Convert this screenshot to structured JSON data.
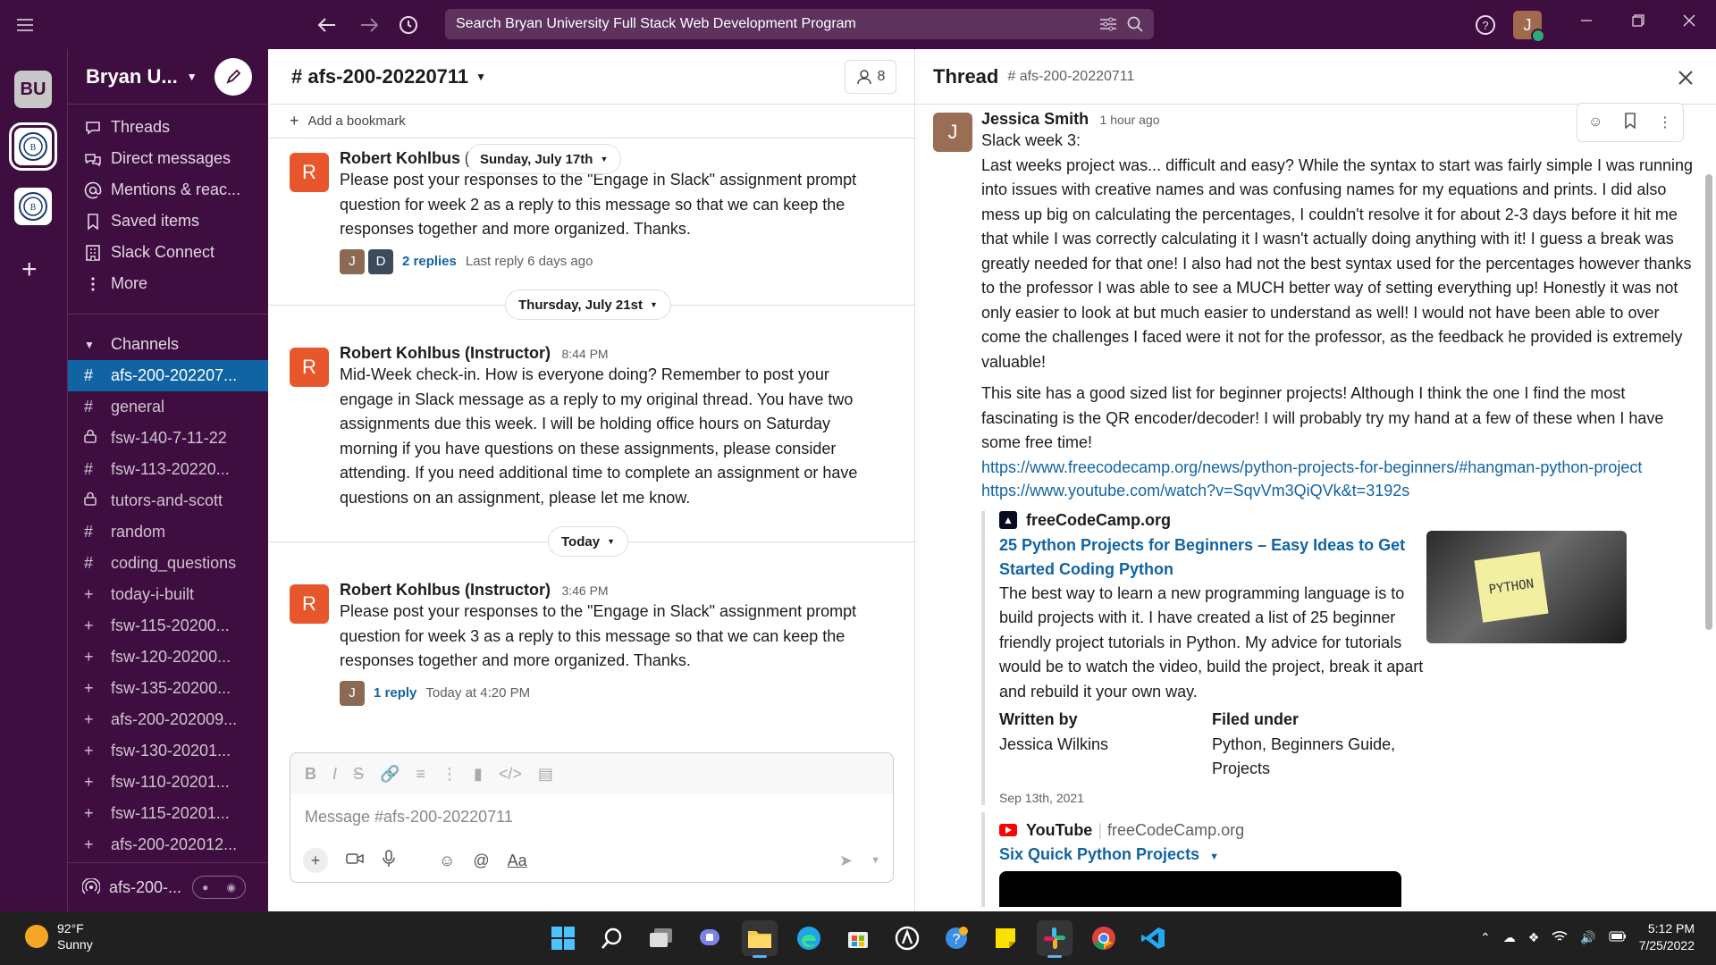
{
  "topbar": {
    "search_placeholder": "Search Bryan University Full Stack Web Development Program",
    "user_initial": "J"
  },
  "rail": {
    "workspace_initials": "BU"
  },
  "sidebar": {
    "workspace_name": "Bryan U...",
    "nav": [
      {
        "label": "Threads",
        "icon": "threads-icon"
      },
      {
        "label": "Direct messages",
        "icon": "dm-icon"
      },
      {
        "label": "Mentions & reac...",
        "icon": "at-icon"
      },
      {
        "label": "Saved items",
        "icon": "bookmark-icon"
      },
      {
        "label": "Slack Connect",
        "icon": "building-icon"
      },
      {
        "label": "More",
        "icon": "more-vertical-icon"
      }
    ],
    "channels_heading": "Channels",
    "channels": [
      {
        "prefix": "#",
        "name": "afs-200-202207..."
      },
      {
        "prefix": "#",
        "name": "general"
      },
      {
        "prefix": "lock",
        "name": "fsw-140-7-11-22"
      },
      {
        "prefix": "#",
        "name": "fsw-113-20220..."
      },
      {
        "prefix": "lock",
        "name": "tutors-and-scott"
      },
      {
        "prefix": "#",
        "name": "random"
      },
      {
        "prefix": "#",
        "name": "coding_questions"
      },
      {
        "prefix": "+",
        "name": "today-i-built"
      },
      {
        "prefix": "+",
        "name": "fsw-115-20200..."
      },
      {
        "prefix": "+",
        "name": "fsw-120-20200..."
      },
      {
        "prefix": "+",
        "name": "fsw-135-20200..."
      },
      {
        "prefix": "+",
        "name": "afs-200-202009..."
      },
      {
        "prefix": "+",
        "name": "fsw-130-20201..."
      },
      {
        "prefix": "+",
        "name": "fsw-110-20201..."
      },
      {
        "prefix": "+",
        "name": "fsw-115-20201..."
      },
      {
        "prefix": "+",
        "name": "afs-200-202012..."
      }
    ],
    "huddle_label": "afs-200-..."
  },
  "channel": {
    "title": "# afs-200-20220711",
    "member_count": "8",
    "bookmark_label": "Add a bookmark",
    "date_pills": [
      "Sunday, July 17th",
      "Thursday, July 21st",
      "Today"
    ],
    "messages": [
      {
        "initial": "R",
        "author": "Robert Kohlbus (Instruc",
        "time": "",
        "text": "Please post your responses to the \"Engage in Slack\" assignment prompt question for week 2 as a reply to this message so that we can keep the responses together and more organized. Thanks.",
        "reply_avatars": [
          "J",
          "D"
        ],
        "reply_count": "2 replies",
        "reply_meta": "Last reply 6 days ago"
      },
      {
        "initial": "R",
        "author": "Robert Kohlbus (Instructor)",
        "time": "8:44 PM",
        "text": "Mid-Week check-in. How is everyone doing?  Remember to post your engage in Slack message as a reply to my original thread.  You have two assignments due this week.  I will be holding office hours on Saturday morning if you have questions on these assignments, please consider attending.  If you need additional time to complete an assignment or have questions on an assignment, please let me know."
      },
      {
        "initial": "R",
        "author": "Robert Kohlbus (Instructor)",
        "time": "3:46 PM",
        "text": "Please post your responses to the \"Engage in Slack\" assignment prompt question for week 3 as a reply to this message so that we can keep the responses together and more organized. Thanks.",
        "reply_avatars": [
          "J"
        ],
        "reply_count": "1 reply",
        "reply_meta": "Today at 4:20 PM"
      }
    ],
    "composer_placeholder": "Message #afs-200-20220711",
    "format_label": "Aa"
  },
  "thread": {
    "title": "Thread",
    "channel": "# afs-200-20220711",
    "author_initial": "J",
    "author": "Jessica Smith",
    "time": "1 hour ago",
    "para1": "Slack week 3:",
    "para2": "Last weeks project was... difficult and easy? While the syntax to start was fairly simple I was running into issues with creative names and was confusing names for my equations and prints. I did also mess up big on calculating the percentages, I couldn't resolve it for about 2-3 days before it hit me that while I was correctly calculating it I wasn't actually doing anything with it! I guess a break was greatly needed for that one! I also had not the best syntax used for the percentages however thanks to the professor I was able to see a MUCH better way of setting everything up! Honestly it was not only easier to look at but much easier to understand as well! I would not have been able to over come the challenges I faced were it not for the professor, as the feedback he provided is extremely valuable!",
    "para3": "This site has a good sized list for beginner projects! Although I think the one I find the most fascinating is the QR encoder/decoder! I will probably try my hand at a few of these when I have some free time!",
    "link1": "https://www.freecodecamp.org/news/python-projects-for-beginners/#hangman-python-project",
    "link2": "https://www.youtube.com/watch?v=SqvVm3QiQVk&t=3192s",
    "unfurl": {
      "site": "freeCodeCamp.org",
      "title": "25 Python Projects for Beginners – Easy Ideas to Get Started Coding Python",
      "description": "The best way to learn a new programming language is to build projects with it. I have created a list of 25 beginner friendly project tutorials in Python. My advice for tutorials would be to watch the video, build the project, break it apart and rebuild it your own way.",
      "written_by_label": "Written by",
      "written_by": "Jessica Wilkins",
      "filed_under_label": "Filed under",
      "filed_under": "Python, Beginners Guide, Projects",
      "date": "Sep 13th, 2021",
      "image_text": "PYTHON"
    },
    "youtube": {
      "site": "YouTube",
      "channel": "freeCodeCamp.org",
      "title": "Six Quick Python Projects"
    }
  },
  "taskbar": {
    "temperature": "92°F",
    "condition": "Sunny",
    "time": "5:12 PM",
    "date": "7/25/2022"
  }
}
